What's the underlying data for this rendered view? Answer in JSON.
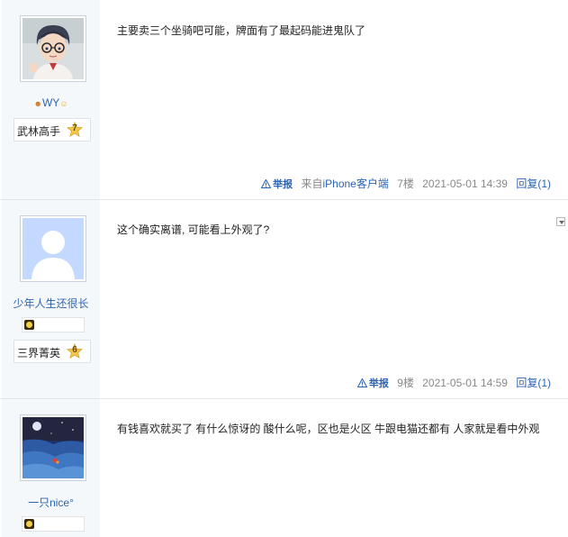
{
  "posts": [
    {
      "username": "WY",
      "rank_title": "武林高手",
      "rank_level": "7",
      "content": "主要卖三个坐骑吧可能，牌面有了最起码能进鬼队了",
      "report": "举报",
      "source_prefix": "来自",
      "source_link": "iPhone客户端",
      "floor": "7楼",
      "time": "2021-05-01 14:39",
      "reply": "回复(1)"
    },
    {
      "username": "少年人生还很长",
      "rank_title": "三界菁英",
      "rank_level": "6",
      "content": "这个确实离谱, 可能看上外观了?",
      "report": "举报",
      "floor": "9楼",
      "time": "2021-05-01 14:59",
      "reply": "回复(1)"
    },
    {
      "username": "一只nice°",
      "content": "有钱喜欢就买了 有什么惊讶的 酸什么呢，区也是火区 牛跟电猫还都有 人家就是看中外观"
    }
  ]
}
